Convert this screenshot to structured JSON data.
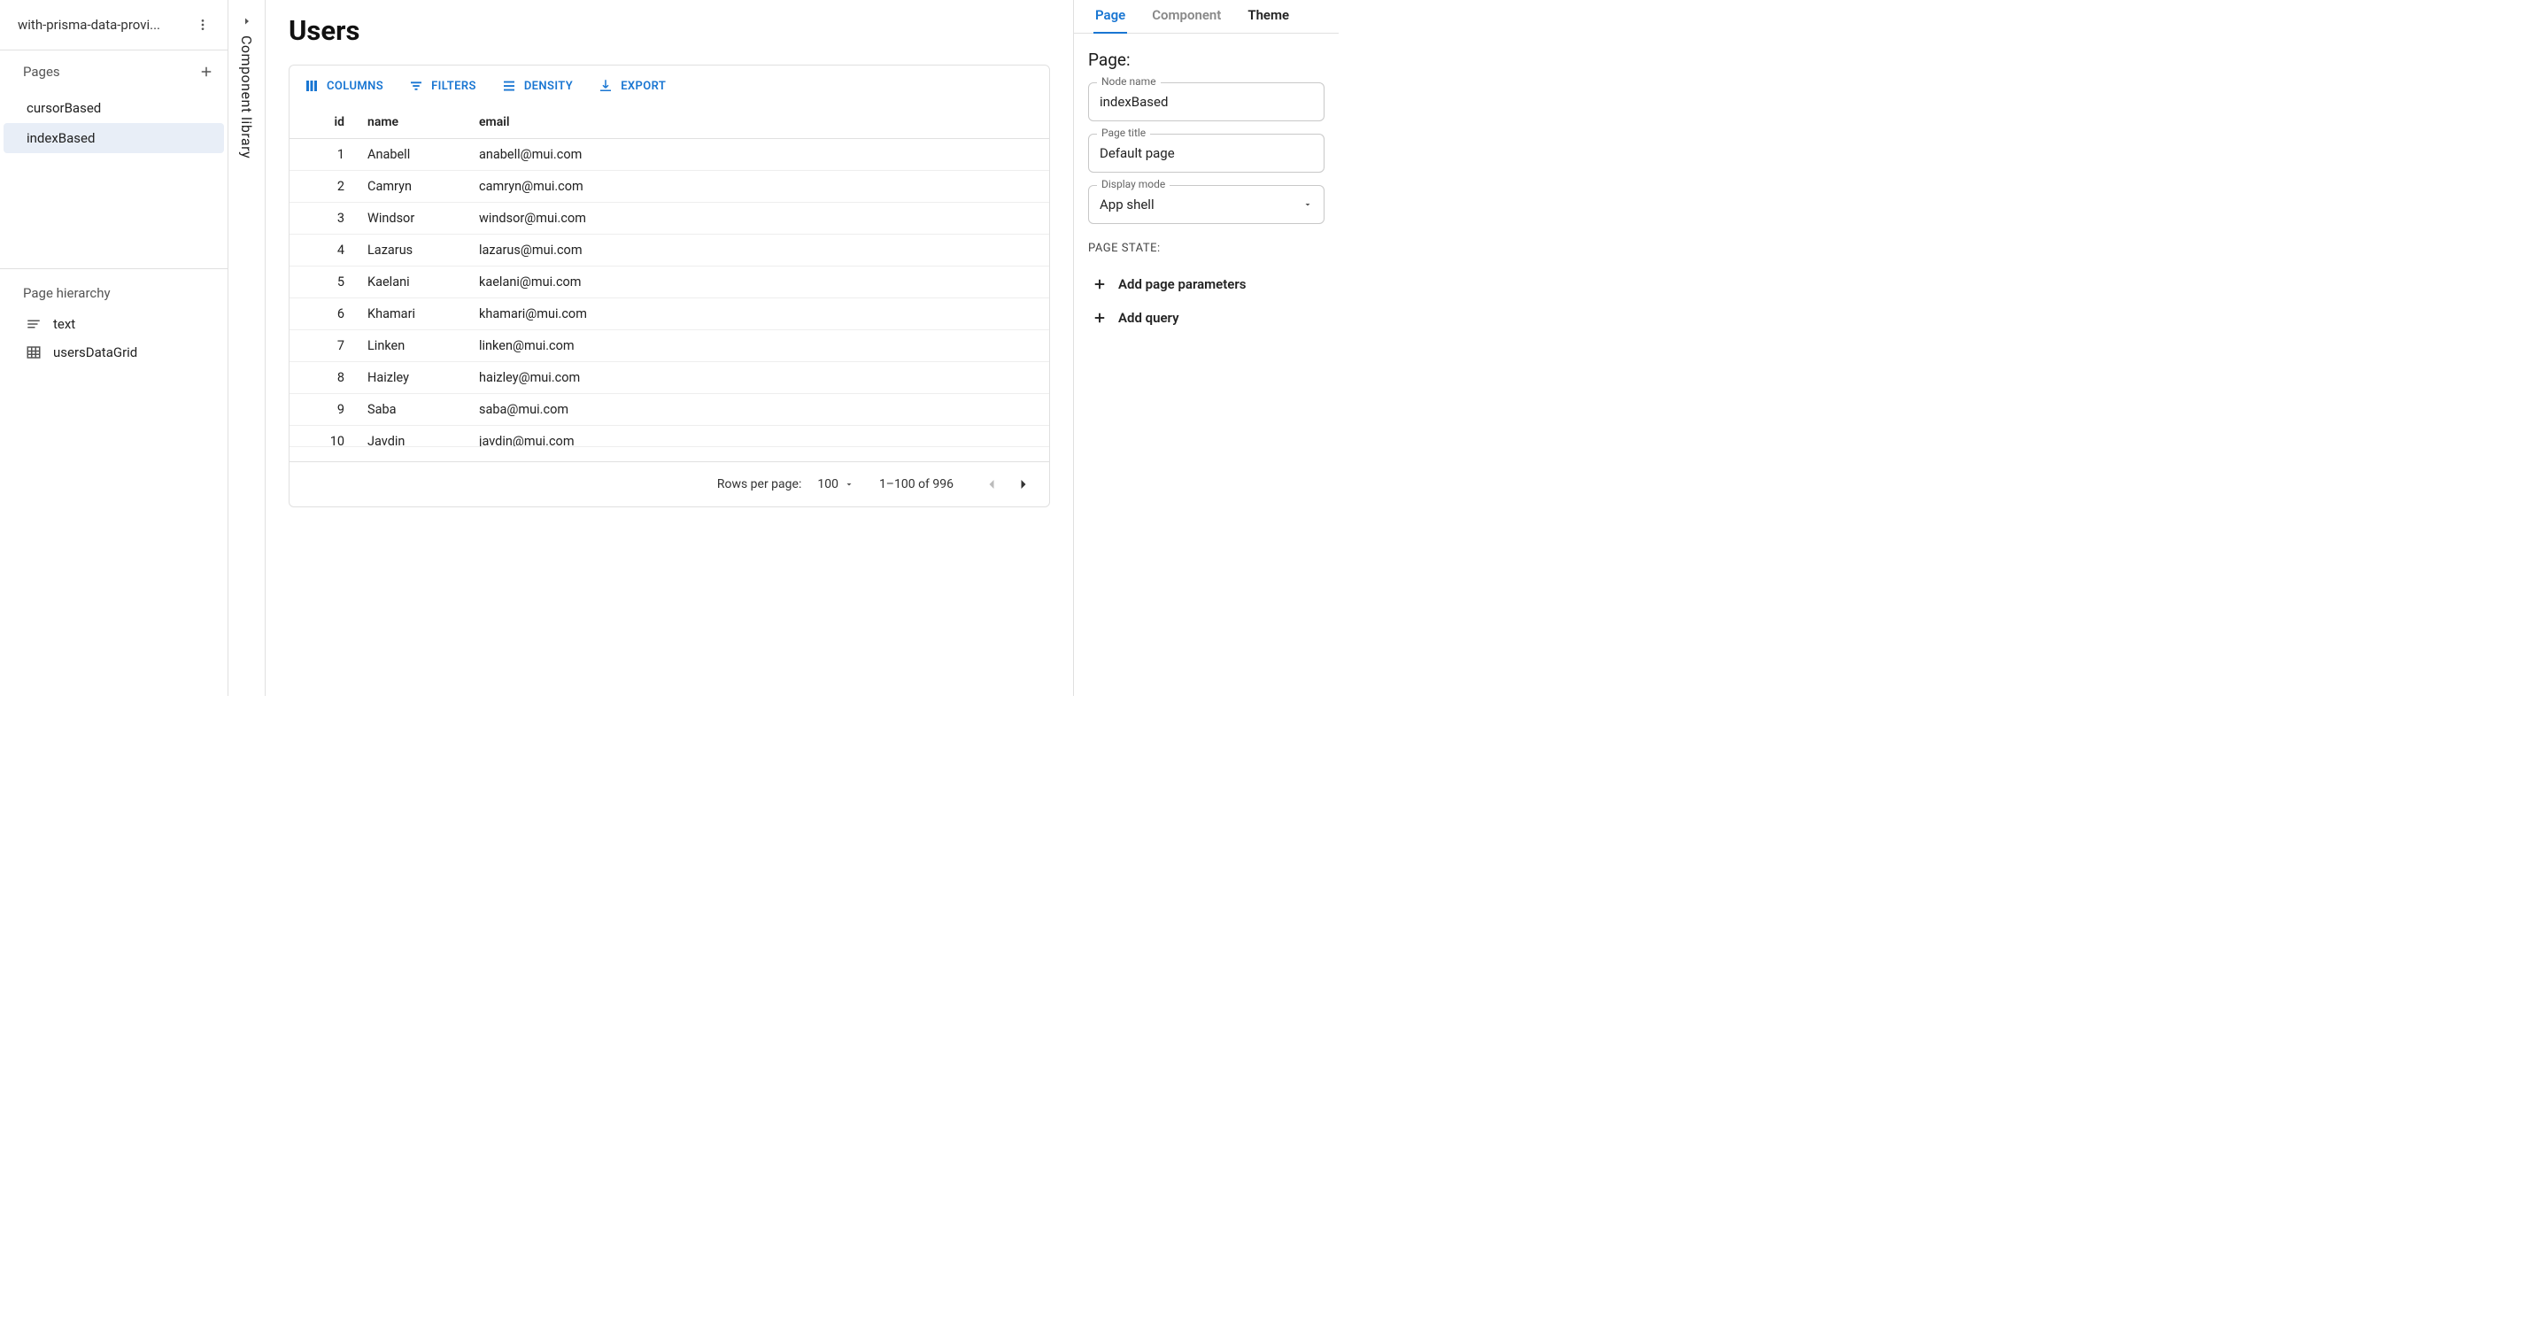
{
  "project": {
    "title": "with-prisma-data-provi..."
  },
  "pages": {
    "section_label": "Pages",
    "items": [
      {
        "label": "cursorBased",
        "selected": false
      },
      {
        "label": "indexBased",
        "selected": true
      }
    ]
  },
  "hierarchy": {
    "header": "Page hierarchy",
    "items": [
      {
        "icon": "text",
        "label": "text"
      },
      {
        "icon": "grid",
        "label": "usersDataGrid"
      }
    ]
  },
  "rail": {
    "label": "Component library"
  },
  "main": {
    "title": "Users",
    "toolbar": {
      "columns": "COLUMNS",
      "filters": "FILTERS",
      "density": "DENSITY",
      "export": "EXPORT"
    },
    "columns": {
      "id": "id",
      "name": "name",
      "email": "email"
    },
    "rows": [
      {
        "id": "1",
        "name": "Anabell",
        "email": "anabell@mui.com"
      },
      {
        "id": "2",
        "name": "Camryn",
        "email": "camryn@mui.com"
      },
      {
        "id": "3",
        "name": "Windsor",
        "email": "windsor@mui.com"
      },
      {
        "id": "4",
        "name": "Lazarus",
        "email": "lazarus@mui.com"
      },
      {
        "id": "5",
        "name": "Kaelani",
        "email": "kaelani@mui.com"
      },
      {
        "id": "6",
        "name": "Khamari",
        "email": "khamari@mui.com"
      },
      {
        "id": "7",
        "name": "Linken",
        "email": "linken@mui.com"
      },
      {
        "id": "8",
        "name": "Haizley",
        "email": "haizley@mui.com"
      },
      {
        "id": "9",
        "name": "Saba",
        "email": "saba@mui.com"
      },
      {
        "id": "10",
        "name": "Javdin",
        "email": "javdin@mui.com"
      }
    ],
    "footer": {
      "rows_per_page_label": "Rows per page:",
      "rows_per_page_value": "100",
      "page_info": "1–100 of 996"
    }
  },
  "right": {
    "tabs": {
      "page": "Page",
      "component": "Component",
      "theme": "Theme"
    },
    "heading": "Page:",
    "fields": {
      "node_name": {
        "label": "Node name",
        "value": "indexBased"
      },
      "page_title": {
        "label": "Page title",
        "value": "Default page"
      },
      "display_mode": {
        "label": "Display mode",
        "value": "App shell"
      }
    },
    "state_heading": "PAGE STATE:",
    "actions": {
      "add_params": "Add page parameters",
      "add_query": "Add query"
    }
  }
}
